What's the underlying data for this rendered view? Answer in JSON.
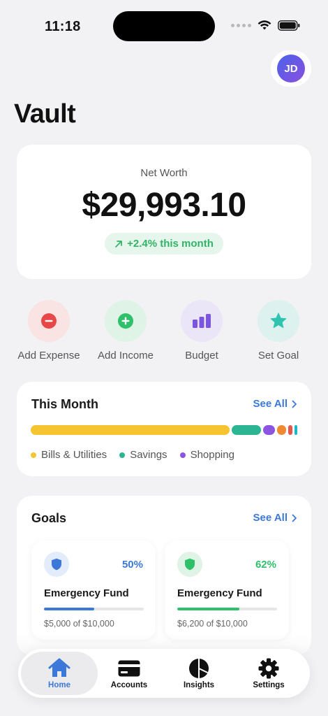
{
  "status_bar": {
    "time": "11:18"
  },
  "header": {
    "avatar_initials": "JD",
    "app_title": "Vault"
  },
  "net_worth": {
    "label": "Net Worth",
    "value": "$29,993.10",
    "change": "+2.4% this month"
  },
  "quick_actions": [
    {
      "label": "Add Expense",
      "icon": "minus-circle-icon",
      "color": "#e64848",
      "bg": "#f9e3e3"
    },
    {
      "label": "Add Income",
      "icon": "plus-circle-icon",
      "color": "#2fc06a",
      "bg": "#dff3e6"
    },
    {
      "label": "Budget",
      "icon": "bar-chart-icon",
      "color": "#7b55e0",
      "bg": "#ebe5f8"
    },
    {
      "label": "Set Goal",
      "icon": "star-icon",
      "color": "#2ec4b0",
      "bg": "#ddf2ef"
    }
  ],
  "this_month": {
    "title": "This Month",
    "see_all": "See All",
    "segments": [
      {
        "name": "Bills & Utilities",
        "share": 75,
        "color": "#f7c431"
      },
      {
        "name": "Savings",
        "share": 11,
        "color": "#2cb592"
      },
      {
        "name": "Shopping",
        "share": 4.5,
        "color": "#8b55e2"
      },
      {
        "name": "",
        "share": 3.5,
        "color": "#f08a32"
      },
      {
        "name": "",
        "share": 1.5,
        "color": "#e8554a"
      },
      {
        "name": "",
        "share": 1,
        "color": "#1fb7c8"
      }
    ],
    "legend": [
      {
        "label": "Bills & Utilities",
        "color": "#f7c431"
      },
      {
        "label": "Savings",
        "color": "#2cb592"
      },
      {
        "label": "Shopping",
        "color": "#8b55e2"
      }
    ]
  },
  "goals": {
    "title": "Goals",
    "see_all": "See All",
    "items": [
      {
        "name": "Emergency Fund",
        "percent": "50%",
        "progress": 0.5,
        "amount": "$5,000 of $10,000",
        "color": "#3b78d9",
        "bg": "#e3ecfb"
      },
      {
        "name": "Emergency Fund",
        "percent": "62%",
        "progress": 0.62,
        "amount": "$6,200 of $10,000",
        "color": "#2fc06a",
        "bg": "#dff3e6"
      }
    ]
  },
  "tab_bar": {
    "tabs": [
      {
        "label": "Home",
        "icon": "home-icon",
        "active": true
      },
      {
        "label": "Accounts",
        "icon": "credit-card-icon",
        "active": false
      },
      {
        "label": "Insights",
        "icon": "pie-chart-icon",
        "active": false
      },
      {
        "label": "Settings",
        "icon": "gear-icon",
        "active": false
      }
    ]
  }
}
